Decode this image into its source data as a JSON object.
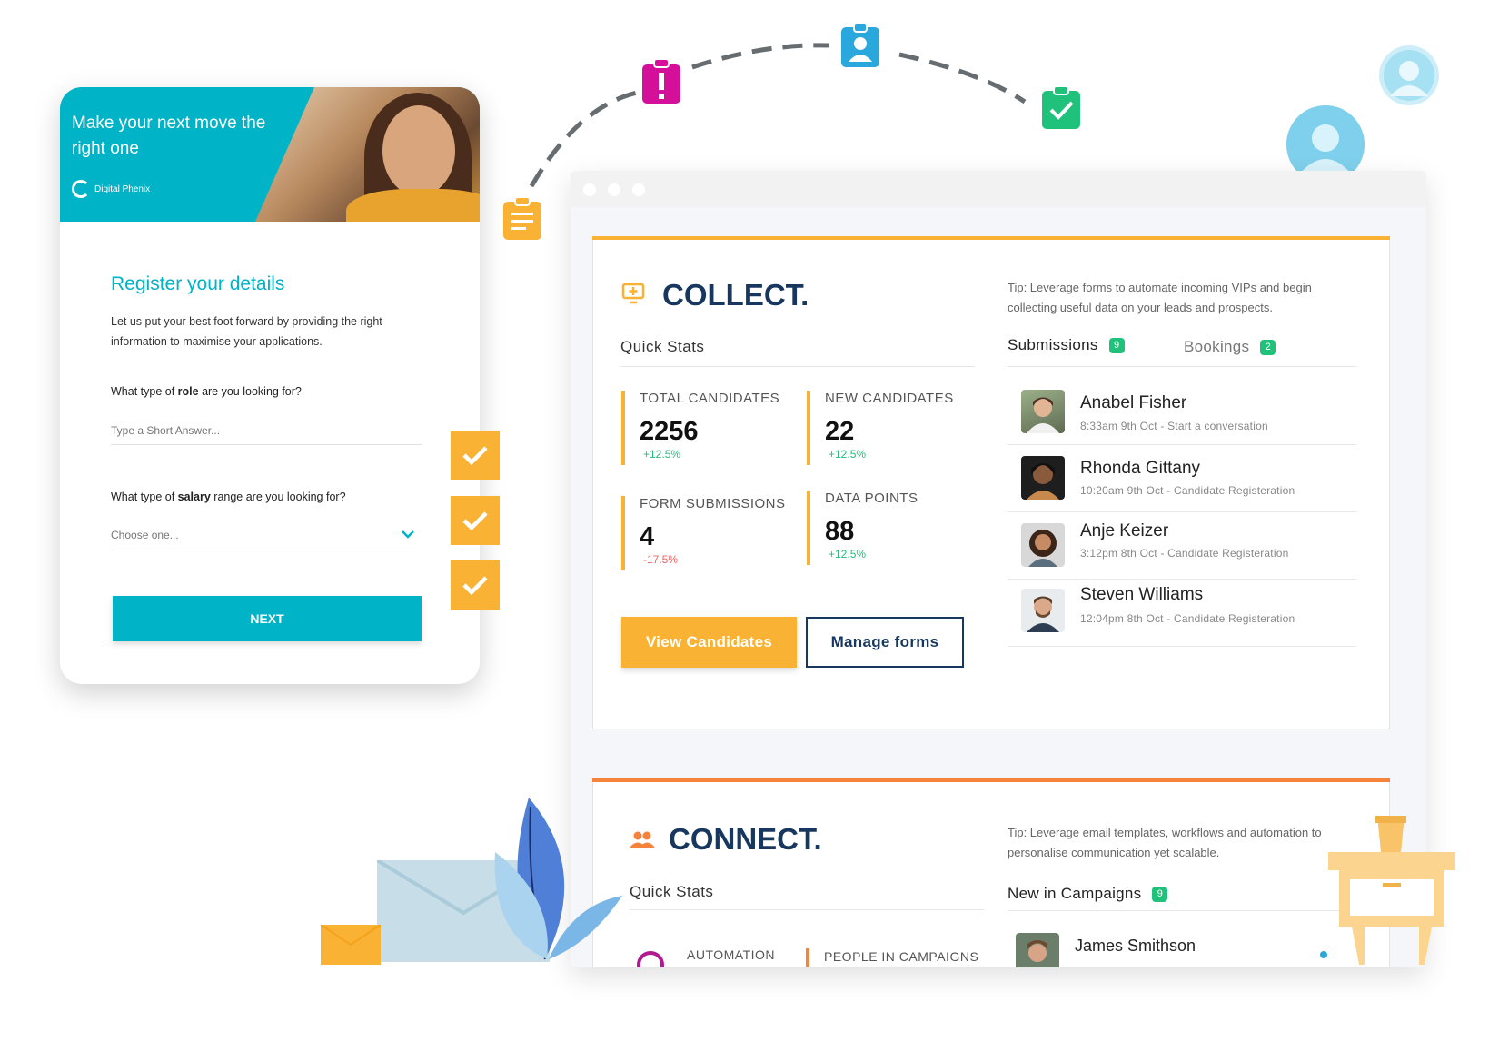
{
  "register_card": {
    "hero_title": "Make your next move the right one",
    "logo_text": "Digital Phenix",
    "title": "Register your details",
    "description": "Let us put your best foot forward by providing the right information to maximise your applications.",
    "question_role_prefix": "What type of ",
    "question_role_bold": "role",
    "question_role_suffix": " are you looking for?",
    "role_placeholder": "Type a Short Answer...",
    "question_salary_prefix": "What type of ",
    "question_salary_bold": "salary",
    "question_salary_suffix": " range are you looking for?",
    "salary_selected": "Choose one...",
    "next_label": "NEXT"
  },
  "collect": {
    "title": "COLLECT.",
    "tip": "Tip: Leverage forms to automate incoming VIPs and begin collecting useful data on your leads and prospects.",
    "quick_stats_label": "Quick Stats",
    "stats": [
      {
        "label": "TOTAL CANDIDATES",
        "value": "2256",
        "change": "+12.5%"
      },
      {
        "label": "NEW CANDIDATES",
        "value": "22",
        "change": "+12.5%"
      },
      {
        "label": "FORM SUBMISSIONS",
        "value": "4",
        "change": "-17.5%"
      },
      {
        "label": "DATA POINTS",
        "value": "88",
        "change": "+12.5%"
      }
    ],
    "view_candidates_label": "View Candidates",
    "manage_forms_label": "Manage forms",
    "tabs": [
      {
        "label": "Submissions",
        "count": "9"
      },
      {
        "label": "Bookings",
        "count": "2"
      }
    ],
    "submissions": [
      {
        "name": "Anabel Fisher",
        "meta": "8:33am 9th Oct - Start a conversation"
      },
      {
        "name": "Rhonda Gittany",
        "meta": "10:20am 9th Oct - Candidate Registeration"
      },
      {
        "name": "Anje Keizer",
        "meta": "3:12pm 8th Oct  - Candidate Registeration"
      },
      {
        "name": "Steven Williams",
        "meta": "12:04pm 8th Oct - Candidate Registeration"
      }
    ]
  },
  "connect": {
    "title": "CONNECT.",
    "tip": "Tip: Leverage email templates, workflows and automation to personalise communication yet scalable.",
    "quick_stats_label": "Quick Stats",
    "stat_labels": [
      "AUTOMATION",
      "PEOPLE IN CAMPAIGNS"
    ],
    "campaigns_label": "New in Campaigns",
    "campaigns_count": "9",
    "first_contact": "James Smithson"
  },
  "colors": {
    "teal": "#00b3c6",
    "yellow": "#f9b234",
    "navy": "#17375e",
    "green": "#1fc17b",
    "red": "#f06262",
    "orange": "#f5833b",
    "magenta": "#d4109a",
    "blue": "#2aa7dc"
  },
  "icons": [
    "clipboard-list-icon",
    "alert-clipboard-icon",
    "contact-badge-icon",
    "check-clipboard-icon",
    "user-avatar-icon",
    "checkmark-icon",
    "monitor-plus-icon",
    "people-icon",
    "chevron-down-icon",
    "envelope-icon",
    "leaf-plant-icon",
    "side-table-icon",
    "coffee-cup-icon"
  ]
}
